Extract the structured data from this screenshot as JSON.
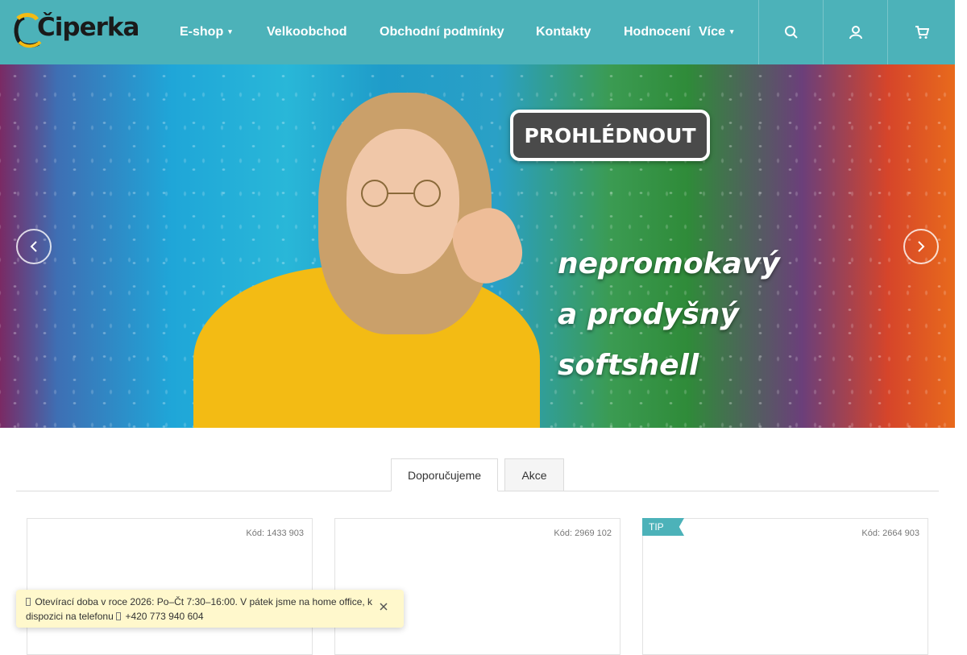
{
  "brand": {
    "logo_text": "Čiperka"
  },
  "nav": {
    "items": [
      {
        "label": "E-shop",
        "has_caret": true
      },
      {
        "label": "Velkoobchod"
      },
      {
        "label": "Obchodní podmínky"
      },
      {
        "label": "Kontakty"
      },
      {
        "label": "Hodnocení"
      },
      {
        "label": "Více",
        "has_caret": true
      }
    ],
    "caret_glyph": "▾"
  },
  "header_buttons": [
    {
      "icon": "search-icon"
    },
    {
      "icon": "user-icon"
    },
    {
      "icon": "cart-icon"
    }
  ],
  "banner": {
    "cta_label": "PROHLÉDNOUT",
    "headline_lines": [
      "nepromokavý",
      "a prodyšný",
      "softshell"
    ]
  },
  "tabs": [
    {
      "label": "Doporučujeme",
      "active": true
    },
    {
      "label": "Akce",
      "active": false
    }
  ],
  "products": [
    {
      "code": "Kód: 1433 903",
      "badge": ""
    },
    {
      "code": "Kód: 2969 102",
      "badge": ""
    },
    {
      "code": "Kód: 2664 903",
      "badge": "TIP"
    }
  ],
  "notice": {
    "text": "Otevírací doba v roce 2026: Po–Čt 7:30–16:00. V pátek jsme na home office, k dispozici na telefonu",
    "phone": "+420 773 940 604"
  },
  "colors": {
    "header": "#4cb2b9",
    "accent": "#4cb2b9",
    "notice_bg": "#fff8cc"
  }
}
